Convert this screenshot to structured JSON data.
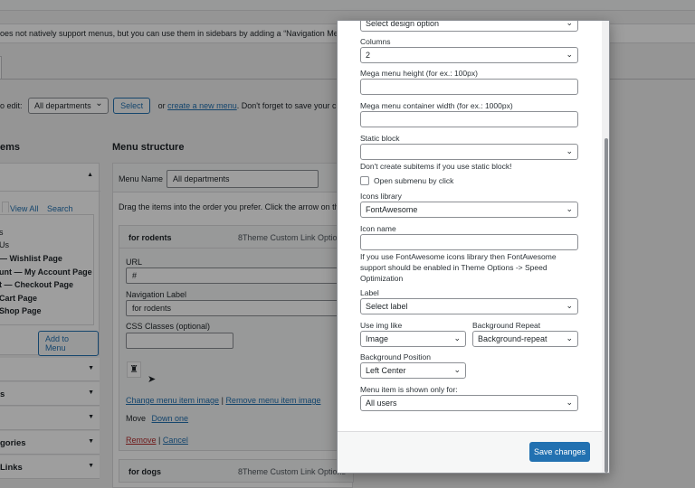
{
  "notice": {
    "text": "oes not natively support menus, but you can use them in sidebars by adding a “Navigation Menu” w"
  },
  "select_row": {
    "prefix": "o edit:",
    "menu_select": "All departments",
    "select_button": "Select",
    "or_text": "or",
    "create_link": "create a new menu",
    "suffix": ". Don't forget to save your change"
  },
  "left": {
    "heading": "ems",
    "tabs": [
      "View All",
      "Search"
    ],
    "items": [
      "s",
      "Us",
      "— Wishlist Page",
      "unt — My Account Page",
      "t — Checkout Page",
      "Cart Page",
      "Shop Page"
    ],
    "add_button": "Add to Menu",
    "accordions": [
      "",
      "s",
      "",
      "gories",
      "Links"
    ]
  },
  "structure": {
    "heading": "Menu structure",
    "menu_name_label": "Menu Name",
    "menu_name_value": "All departments",
    "drag_hint": "Drag the items into the order you prefer. Click the arrow on the r",
    "item1": {
      "title": "for rodents",
      "type": "8Theme Custom Link Options",
      "url_label": "URL",
      "url_value": "#",
      "nav_label": "Navigation Label",
      "nav_value": "for rodents",
      "css_label": "CSS Classes (optional)",
      "change_image": "Change menu item image",
      "sep": "|",
      "remove_image": "Remove menu item image",
      "move": "Move",
      "down_one": "Down one",
      "remove": "Remove",
      "cancel": "Cancel"
    },
    "item2": {
      "title": "for dogs",
      "type": "8Theme Custom Link Options"
    }
  },
  "modal": {
    "design_select": "Select design option",
    "columns_label": "Columns",
    "columns_value": "2",
    "mega_height_label": "Mega menu height (for ex.: 100px)",
    "mega_width_label": "Mega menu container width (for ex.: 1000px)",
    "static_block_label": "Static block",
    "static_block_value": "",
    "static_note": "Don't create subitems if you use static block!",
    "open_submenu_label": "Open submenu by click",
    "icons_library_label": "Icons library",
    "icons_library_value": "FontAwesome",
    "icon_name_label": "Icon name",
    "icon_note": "If you use FontAwesome icons library then FontAwesome support should be enabled in Theme Options -> Speed Optimization",
    "label_label": "Label",
    "label_value": "Select label",
    "use_img_label": "Use img like",
    "use_img_value": "Image",
    "bg_repeat_label": "Background Repeat",
    "bg_repeat_value": "Background-repeat",
    "bg_position_label": "Background Position",
    "bg_position_value": "Left Center",
    "shown_for_label": "Menu item is shown only for:",
    "shown_for_value": "All users",
    "save_button": "Save changes"
  },
  "colors": {
    "primary": "#2271b1",
    "removeLink": "#b32d2e"
  }
}
